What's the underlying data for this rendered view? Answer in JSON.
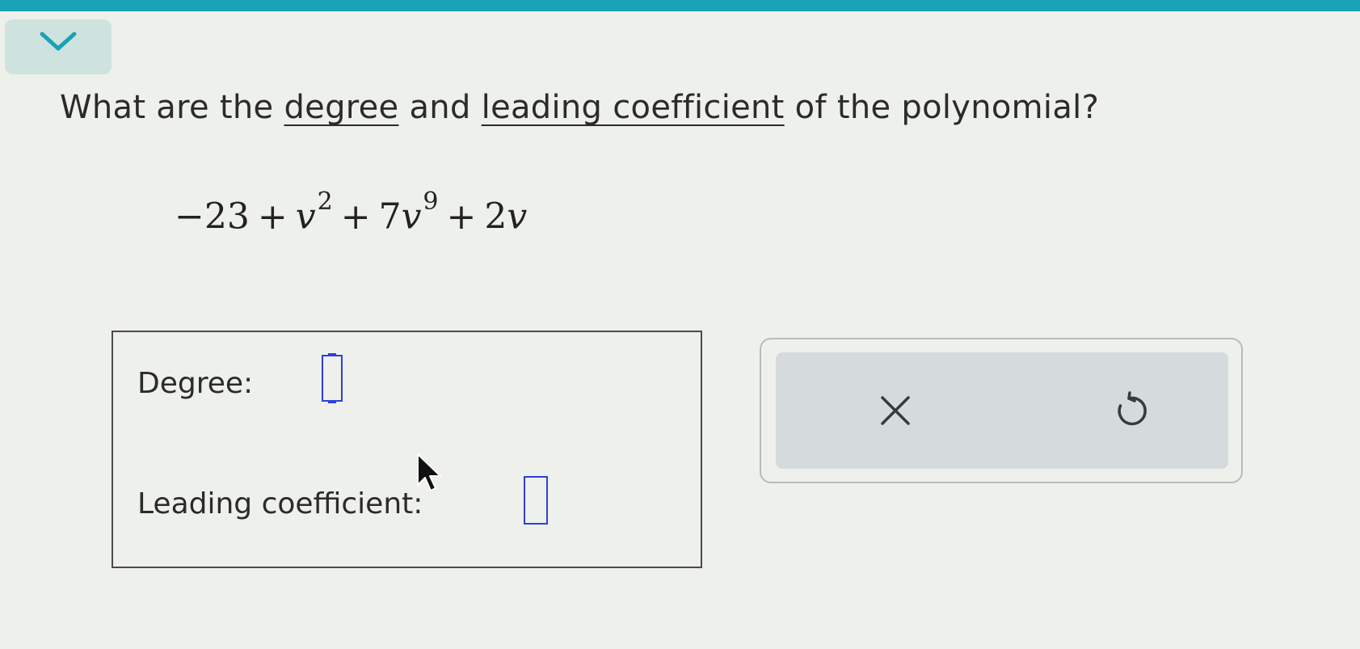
{
  "header": {
    "collapse_icon": "chevron-down-icon",
    "accent_color": "#1aa3b6"
  },
  "question": {
    "prefix": "What are the ",
    "term1": "degree",
    "middle": " and ",
    "term2": "leading coefficient",
    "suffix": " of the polynomial?"
  },
  "polynomial": {
    "c0": "−23",
    "plus": "+",
    "var": "v",
    "exp2": "2",
    "coef9": "7",
    "exp9": "9",
    "coef1": "2"
  },
  "answers": {
    "degree_label": "Degree:",
    "degree_value": "",
    "leading_label": "Leading coefficient:",
    "leading_value": ""
  },
  "actions": {
    "clear_icon": "close-icon",
    "undo_icon": "undo-icon"
  },
  "colors": {
    "input_border": "#2f3fd8"
  }
}
